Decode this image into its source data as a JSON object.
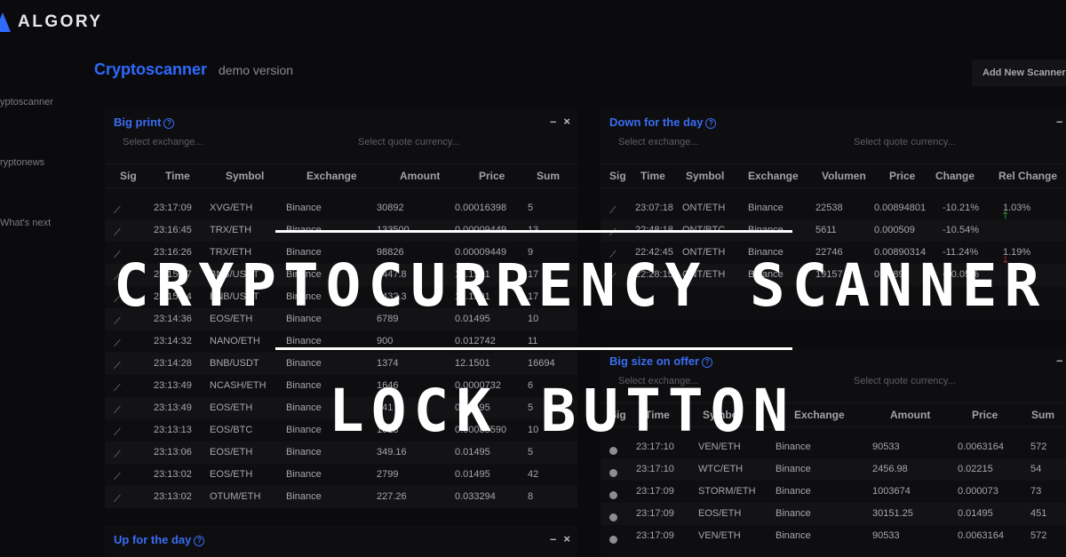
{
  "brand": {
    "name": "ALGORY"
  },
  "sidebar": {
    "items": [
      {
        "label": "yptoscanner"
      },
      {
        "label": "ryptonews"
      },
      {
        "label": "What's next"
      }
    ]
  },
  "page": {
    "title": "Cryptoscanner",
    "subtitle": "demo version",
    "add_button": "Add New Scanner"
  },
  "panels": {
    "big_print": {
      "title": "Big print",
      "help": "?",
      "minimize": "–",
      "close": "×",
      "exchange_placeholder": "Select exchange...",
      "quote_placeholder": "Select quote currency...",
      "columns": [
        "Sig",
        "Time",
        "Symbol",
        "Exchange",
        "Amount",
        "Price",
        "Sum"
      ],
      "rows": [
        [
          "23:17:09",
          "XVG/ETH",
          "Binance",
          "30892",
          "0.00016398",
          "5"
        ],
        [
          "23:16:45",
          "TRX/ETH",
          "Binance",
          "133500",
          "0.00009449",
          "13"
        ],
        [
          "23:16:26",
          "TRX/ETH",
          "Binance",
          "98826",
          "0.00009449",
          "9"
        ],
        [
          "23:15:37",
          "BNB/USDT",
          "Binance",
          "1447.8",
          "12.1501",
          "17"
        ],
        [
          "23:15:24",
          "BNB/USDT",
          "Binance",
          "1432.3",
          "12.1501",
          "17"
        ],
        [
          "23:14:36",
          "EOS/ETH",
          "Binance",
          "6789",
          "0.01495",
          "10"
        ],
        [
          "23:14:32",
          "NANO/ETH",
          "Binance",
          "900",
          "0.012742",
          "11"
        ],
        [
          "23:14:28",
          "BNB/USDT",
          "Binance",
          "1374",
          "12.1501",
          "16694"
        ],
        [
          "23:13:49",
          "NCASH/ETH",
          "Binance",
          "1646",
          "0.0000732",
          "6"
        ],
        [
          "23:13:49",
          "EOS/ETH",
          "Binance",
          "341",
          "0.01495",
          "5"
        ],
        [
          "23:13:13",
          "EOS/BTC",
          "Binance",
          "1013",
          "0.00085590",
          "10"
        ],
        [
          "23:13:06",
          "EOS/ETH",
          "Binance",
          "349.16",
          "0.01495",
          "5"
        ],
        [
          "23:13:02",
          "EOS/ETH",
          "Binance",
          "2799",
          "0.01495",
          "42"
        ],
        [
          "23:13:02",
          "OTUM/ETH",
          "Binance",
          "227.26",
          "0.033294",
          "8"
        ]
      ]
    },
    "down_day": {
      "title": "Down for the day",
      "help": "?",
      "minimize": "–",
      "close": "×",
      "exchange_placeholder": "Select exchange...",
      "quote_placeholder": "Select quote currency...",
      "columns": [
        "Sig",
        "Time",
        "Symbol",
        "Exchange",
        "Volumen",
        "Price",
        "Change",
        "Rel Change"
      ],
      "rows": [
        [
          "23:07:18",
          "ONT/ETH",
          "Binance",
          "22538",
          "0.00894801",
          "-10.21%",
          "1.03%",
          "up"
        ],
        [
          "22:48:18",
          "ONT/BTC",
          "Binance",
          "5611",
          "0.000509",
          "-10.54%",
          "",
          ""
        ],
        [
          "22:42:45",
          "ONT/ETH",
          "Binance",
          "22746",
          "0.00890314",
          "-11.24%",
          "1.19%",
          "down"
        ],
        [
          "22:28:15",
          "ONT/ETH",
          "Binance",
          "19157",
          "0.00892",
          "-10.05%",
          "",
          ""
        ]
      ]
    },
    "big_size": {
      "title": "Big size on offer",
      "help": "?",
      "minimize": "–",
      "close": "×",
      "exchange_placeholder": "Select exchange...",
      "quote_placeholder": "Select quote currency...",
      "columns": [
        "Sig",
        "Time",
        "Symbol",
        "Exchange",
        "Amount",
        "Price",
        "Sum"
      ],
      "rows": [
        [
          "23:17:10",
          "VEN/ETH",
          "Binance",
          "90533",
          "0.0063164",
          "572"
        ],
        [
          "23:17:10",
          "WTC/ETH",
          "Binance",
          "2456.98",
          "0.02215",
          "54"
        ],
        [
          "23:17:09",
          "STORM/ETH",
          "Binance",
          "1003674",
          "0.000073",
          "73"
        ],
        [
          "23:17:09",
          "EOS/ETH",
          "Binance",
          "30151.25",
          "0.01495",
          "451"
        ],
        [
          "23:17:09",
          "VEN/ETH",
          "Binance",
          "90533",
          "0.0063164",
          "572"
        ]
      ]
    },
    "up_day": {
      "title": "Up for the day",
      "help": "?",
      "minimize": "–",
      "close": "×"
    }
  },
  "overlay": {
    "line1": "CRYPTOCURRENCY SCANNER",
    "line2": "LOCK BUTTON"
  },
  "colors": {
    "accent": "#2e69ff",
    "background": "#0b0b0d",
    "up": "#3ec83e",
    "down": "#e23a3a"
  }
}
